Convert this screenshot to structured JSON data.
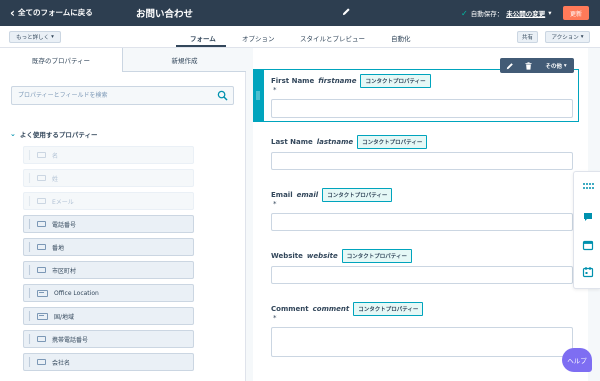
{
  "topbar": {
    "back_label": "全てのフォームに戻る",
    "form_title": "お問い合わせ",
    "autosave_label": "自動保存：",
    "autosave_changes": "未公開の変更",
    "update_label": "更新"
  },
  "tabbar": {
    "more_label": "もっと詳しく",
    "tabs": [
      "フォーム",
      "オプション",
      "スタイルとプレビュー",
      "自動化"
    ],
    "share_label": "共有",
    "actions_label": "アクション"
  },
  "left_panel": {
    "tab_existing": "既存のプロパティー",
    "tab_new": "新規作成",
    "search_placeholder": "プロパティーとフィールドを検索",
    "section_title": "よく使用するプロパティー",
    "properties": [
      {
        "label": "名",
        "disabled": true,
        "icon": "text-field-icon"
      },
      {
        "label": "姓",
        "disabled": true,
        "icon": "text-field-icon"
      },
      {
        "label": "Eメール",
        "disabled": true,
        "icon": "text-field-icon"
      },
      {
        "label": "電話番号",
        "disabled": false,
        "icon": "phone-field-icon"
      },
      {
        "label": "番地",
        "disabled": false,
        "icon": "text-field-icon"
      },
      {
        "label": "市区町村",
        "disabled": false,
        "icon": "text-field-icon"
      },
      {
        "label": "Office Location",
        "disabled": false,
        "icon": "textarea-field-icon"
      },
      {
        "label": "国/地域",
        "disabled": false,
        "icon": "textarea-field-icon"
      },
      {
        "label": "携帯電話番号",
        "disabled": false,
        "icon": "phone-field-icon"
      },
      {
        "label": "会社名",
        "disabled": false,
        "icon": "text-field-icon"
      }
    ]
  },
  "field_toolbar": {
    "more_label": "その他"
  },
  "form_fields": [
    {
      "label": "First Name",
      "api_name": "firstname",
      "tag": "コンタクトプロパティー",
      "required": "*"
    },
    {
      "label": "Last Name",
      "api_name": "lastname",
      "tag": "コンタクトプロパティー",
      "required": ""
    },
    {
      "label": "Email",
      "api_name": "email",
      "tag": "コンタクトプロパティー",
      "required": "*"
    },
    {
      "label": "Website",
      "api_name": "website",
      "tag": "コンタクトプロパティー",
      "required": ""
    },
    {
      "label": "Comment",
      "api_name": "comment",
      "tag": "コンタクトプロパティー",
      "required": "*"
    }
  ],
  "help_label": "ヘルプ",
  "colors": {
    "topbar": "#2d3e50",
    "accent_teal": "#00a4bd",
    "update_orange": "#ff7a59",
    "help_purple": "#7e6ef2",
    "autosave_check": "#00bda5"
  }
}
